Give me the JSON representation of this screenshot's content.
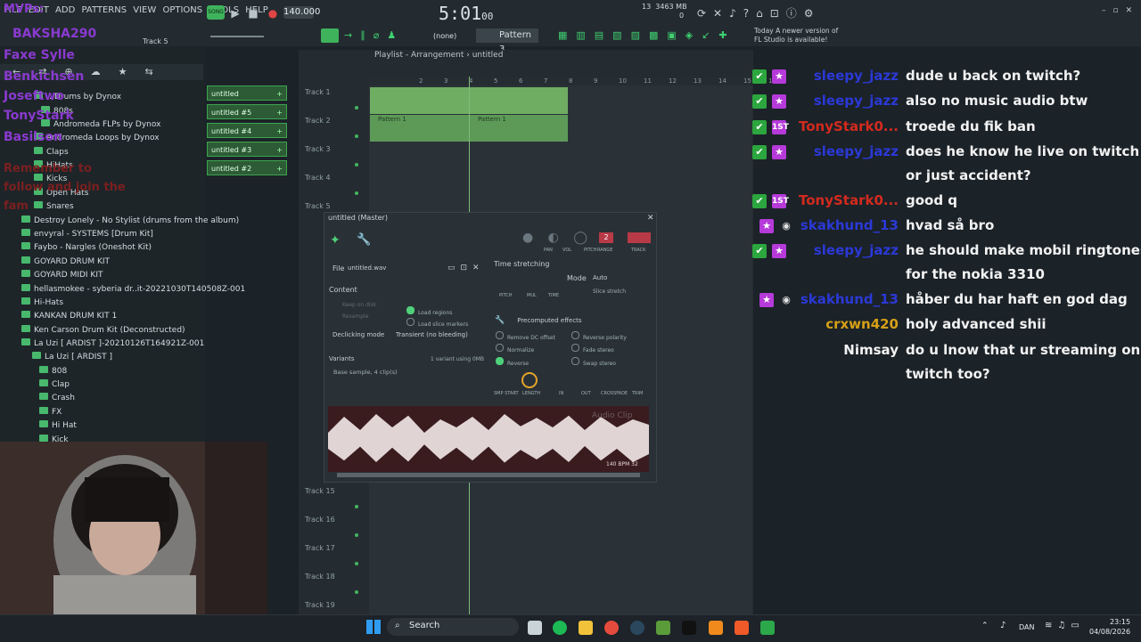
{
  "menu": [
    "FILE",
    "EDIT",
    "ADD",
    "PATTERNS",
    "VIEW",
    "OPTIONS",
    "TOOLS",
    "HELP"
  ],
  "transport": {
    "song_label": "SONG",
    "tempo": "140.000",
    "time": "5:01",
    "time_small": "00"
  },
  "cpu": {
    "cores": "13",
    "memory": "3463 MB",
    "voices": "0"
  },
  "pattern": {
    "label": "Pattern 3",
    "none_label": "(none)"
  },
  "news": {
    "date": "Today",
    "text": "A newer version of",
    "text2": "FL Studio is available!"
  },
  "browser_track_label": "Track 5",
  "browser": {
    "items": [
      "…Drums by Dynox",
      "808s",
      "Andromeda FLPs by Dynox",
      "Andromeda Loops by Dynox",
      "Claps",
      "HiHats",
      "Kicks",
      "Open Hats",
      "Snares",
      "Destroy Lonely - No Stylist (drums from the album)",
      "envyral - SYSTEMS [Drum Kit]",
      "Faybo - Nargles (Oneshot Kit)",
      "GOYARD DRUM KIT",
      "GOYARD MIDI KIT",
      "hellasmokee - syberia dr..it-20221030T140508Z-001",
      "Hi-Hats",
      "KANKAN DRUM KIT 1",
      "Ken Carson Drum Kit (Deconstructed)",
      "La Uzi [ ARDIST ]-20210126T164921Z-001",
      "La Uzi [ ARDIST ]",
      "808",
      "Clap",
      "Crash",
      "FX",
      "Hi Hat",
      "Kick"
    ]
  },
  "channels": [
    "untitled",
    "untitled #5",
    "untitled #4",
    "untitled #3",
    "untitled #2"
  ],
  "playlist": {
    "title": "Playlist - Arrangement",
    "subtitle": "untitled",
    "ruler": [
      "2",
      "3",
      "4",
      "5",
      "6",
      "7",
      "8",
      "9",
      "10",
      "11",
      "12",
      "13",
      "14",
      "15",
      "16"
    ],
    "tracks": [
      "Track 1",
      "Track 2",
      "Track 3",
      "Track 4",
      "Track 5",
      "Track 15",
      "Track 16",
      "Track 17",
      "Track 18",
      "Track 19"
    ],
    "pattern_clip": "Pattern 1"
  },
  "sampler": {
    "title": "untitled (Master)",
    "file_label": "File",
    "file_value": "untitled.wav",
    "knob_labels": [
      "PAN",
      "VOL",
      "PITCH",
      "RANGE",
      "TRACK"
    ],
    "pitch_value": "2",
    "time_stretching": "Time stretching",
    "stretch_knobs": [
      "PITCH",
      "MUL",
      "TIME"
    ],
    "mode_label": "Mode",
    "mode_value": "Auto",
    "slice_stretch": "Slice stretch",
    "content": "Content",
    "keep_on_disk": "Keep on disk",
    "resample": "Resample",
    "load_regions": "Load regions",
    "load_slice_markers": "Load slice markers",
    "precomputed": "Precomputed effects",
    "declicking_label": "Declicking mode",
    "declicking_value": "Transient (no bleeding)",
    "options": [
      "Remove DC offset",
      "Normalize",
      "Reverse",
      "Reverse polarity",
      "Fade stereo",
      "Swap stereo"
    ],
    "variants": "Variants",
    "variant_info": "1 variant using 0MB",
    "base_sample": "Base sample, 4 clip(s)",
    "bottom_knobs": [
      "SMP START",
      "LENGTH",
      "IN",
      "OUT",
      "CROSSFADE",
      "TRIM"
    ],
    "wave_info": "140 BPM 32",
    "audio_clip": "Audio Clip"
  },
  "overlay": {
    "line1": "MVPs:",
    "line2": "BAKSHA290",
    "line3": "Faxe Sylle",
    "line4": "Benkichsen",
    "line5": "Joseftwo",
    "line6": "TonyStark",
    "line7": "Basilson",
    "reminder1": "Remember to",
    "reminder2": "follow and join the",
    "reminder3": "fam"
  },
  "chat": [
    {
      "name": "sleepy_jazz",
      "color": "#2b39d6",
      "badges": [
        "mod",
        "vip"
      ],
      "msg": "dude u back on twitch?"
    },
    {
      "name": "sleepy_jazz",
      "color": "#2b39d6",
      "badges": [
        "mod",
        "vip"
      ],
      "msg": "also no music audio btw"
    },
    {
      "name": "TonyStark0...",
      "color": "#d42a1e",
      "badges": [
        "mod",
        "1st"
      ],
      "msg": "troede du fik ban"
    },
    {
      "name": "sleepy_jazz",
      "color": "#2b39d6",
      "badges": [
        "mod",
        "vip"
      ],
      "msg": "does he know he live on twitch",
      "msg2": "or just accident?"
    },
    {
      "name": "TonyStark0...",
      "color": "#d42a1e",
      "badges": [
        "mod",
        "1st"
      ],
      "msg": "good q"
    },
    {
      "name": "skakhund_13",
      "color": "#2b39d6",
      "badges": [
        "vip",
        "eye"
      ],
      "msg": "hvad så bro"
    },
    {
      "name": "sleepy_jazz",
      "color": "#2b39d6",
      "badges": [
        "mod",
        "vip"
      ],
      "msg": "he should make mobil ringtones",
      "msg2": "for the nokia 3310"
    },
    {
      "name": "skakhund_13",
      "color": "#2b39d6",
      "badges": [
        "vip",
        "eye"
      ],
      "msg": "håber du har haft en god dag"
    },
    {
      "name": "crxwn420",
      "color": "#d6a016",
      "badges": [],
      "msg": "holy advanced shii"
    },
    {
      "name": "Nimsay",
      "color": "#f2f2f2",
      "badges": [],
      "msg": "do u lnow that ur streaming on",
      "msg2": "twitch too?"
    }
  ],
  "taskbar": {
    "search": "Search",
    "lang": "DAN",
    "time": "23:15",
    "date": "04/08/2026"
  }
}
